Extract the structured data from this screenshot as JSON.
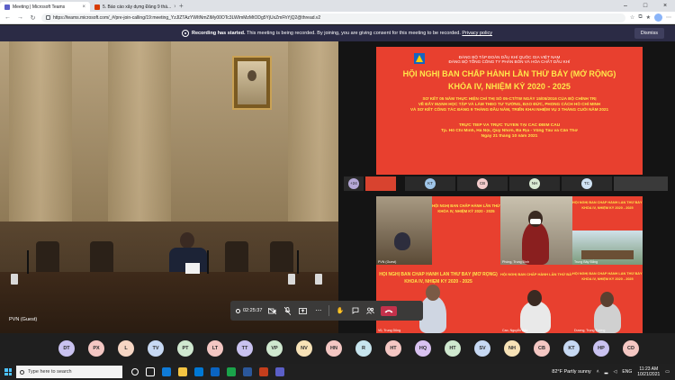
{
  "browser": {
    "tabs": [
      {
        "title": "Meeting | Microsoft Teams",
        "favicon_color": "#5b5fc7"
      },
      {
        "title": "5. Báo cáo xây dựng Đảng 9 thá...",
        "favicon_color": "#d83b01"
      }
    ],
    "url": "https://teams.microsoft.com/_#/pre-join-calling/19:meeting_YzJlZTAzYWItNmZiMy00OTc3LWImMzMtODg5YjUxZmFhYjQ2@thread.v2"
  },
  "banner": {
    "bold": "Recording has started.",
    "text": " This meeting is being recorded. By joining, you are giving consent for this meeting to be recorded. ",
    "link": "Privacy policy",
    "dismiss": "Dismiss"
  },
  "left_video": {
    "name_label": "PVN (Guest)"
  },
  "slide": {
    "line1": "ĐẢNG BỘ TẬP ĐOÀN DẦU KHÍ QUỐC GIA VIỆT NAM",
    "line2": "ĐẢNG BỘ TỔNG CÔNG TY PHÂN BÓN VÀ HÓA CHẤT DẦU KHÍ",
    "title1": "HỘI NGHỊ BAN CHẤP HÀNH LẦN THỨ BẢY (MỞ RỘNG)",
    "title2": "KHÓA IV, NHIỆM KỲ 2020 - 2025",
    "body1": "SƠ KẾT 05 NĂM THỰC HIỆN CHỈ THỊ SỐ 05-CT/TW NGÀY 15/05/2016 CỦA BỘ CHÍNH TRỊ",
    "body2": "VỀ ĐẨY MẠNH HỌC TẬP VÀ LÀM THEO TƯ TƯỞNG, ĐẠO ĐỨC, PHONG CÁCH HỒ CHÍ MINH",
    "body3": "VÀ SƠ KẾT CÔNG TÁC ĐẢNG 9 THÁNG ĐẦU NĂM, TRIỂN KHAI NHIỆM VỤ 3 THÁNG CUỐI NĂM 2021",
    "body4": "",
    "venue1": "TRỰC TIẾP VÀ TRỰC TUYẾN TẠI CÁC ĐIỂM CẦU",
    "venue2": "Tp. Hồ Chí Minh, Hà Nội, Quy Nhơn, Bà Rịa - Vũng Tàu và Cần Thơ",
    "venue3": "Ngày 21 tháng 10 năm 2021",
    "logo_color": "#1565c0"
  },
  "strip": [
    {
      "initials": "+24",
      "color": "#b4a7d6"
    },
    {
      "initials": "KT",
      "color": "#9fc5e8"
    },
    {
      "initials": "CB",
      "color": "#f4cccc"
    },
    {
      "initials": "NH",
      "color": "#d9ead3"
    },
    {
      "initials": "TC",
      "color": "#cfe2f3"
    }
  ],
  "grid": {
    "slide_title_a": "HỘI NGHỊ BAN CHẤP HÀNH LẦN THỨ BẢY (MỞ RỘNG)",
    "slide_title_b": "KHÓA IV, NHIỆM KỲ 2020 - 2025",
    "tags": [
      "PVN (Guest)",
      "Phòng, Trung Đình",
      "Trung Bảy Đắng",
      "Vũ, Trung Dũng",
      "Cao, Nguyễn Bảo",
      "Dương, Trọng Tường"
    ]
  },
  "controls": {
    "timer": "02:25:37"
  },
  "avatars": [
    {
      "initials": "DT",
      "color": "#c9c2f0"
    },
    {
      "initials": "PX",
      "color": "#f4c7c3"
    },
    {
      "initials": "L",
      "color": "#f7d6c4"
    },
    {
      "initials": "TV",
      "color": "#c7d9f3"
    },
    {
      "initials": "PT",
      "color": "#cfe8cf"
    },
    {
      "initials": "LT",
      "color": "#f4c7c3"
    },
    {
      "initials": "TT",
      "color": "#c9c2f0"
    },
    {
      "initials": "VP",
      "color": "#cfe8cf"
    },
    {
      "initials": "NV",
      "color": "#f7e2b7"
    },
    {
      "initials": "HN",
      "color": "#f4c7c3"
    },
    {
      "initials": "R",
      "color": "#c7e5ee"
    },
    {
      "initials": "HT",
      "color": "#f4c7c3"
    },
    {
      "initials": "HQ",
      "color": "#d9c2f0"
    },
    {
      "initials": "HT",
      "color": "#cfe8cf"
    },
    {
      "initials": "SV",
      "color": "#c7d9f3"
    },
    {
      "initials": "NH",
      "color": "#f7e2b7"
    },
    {
      "initials": "CB",
      "color": "#f4c7c3"
    },
    {
      "initials": "KT",
      "color": "#c7d9f3"
    },
    {
      "initials": "HP",
      "color": "#c9c2f0"
    },
    {
      "initials": "CD",
      "color": "#f4c7c3"
    }
  ],
  "taskbar": {
    "search_placeholder": "Type here to search",
    "weather": "82°F  Partly sunny",
    "lang": "ENG",
    "time": "11:23 AM",
    "date": "10/21/2021"
  }
}
